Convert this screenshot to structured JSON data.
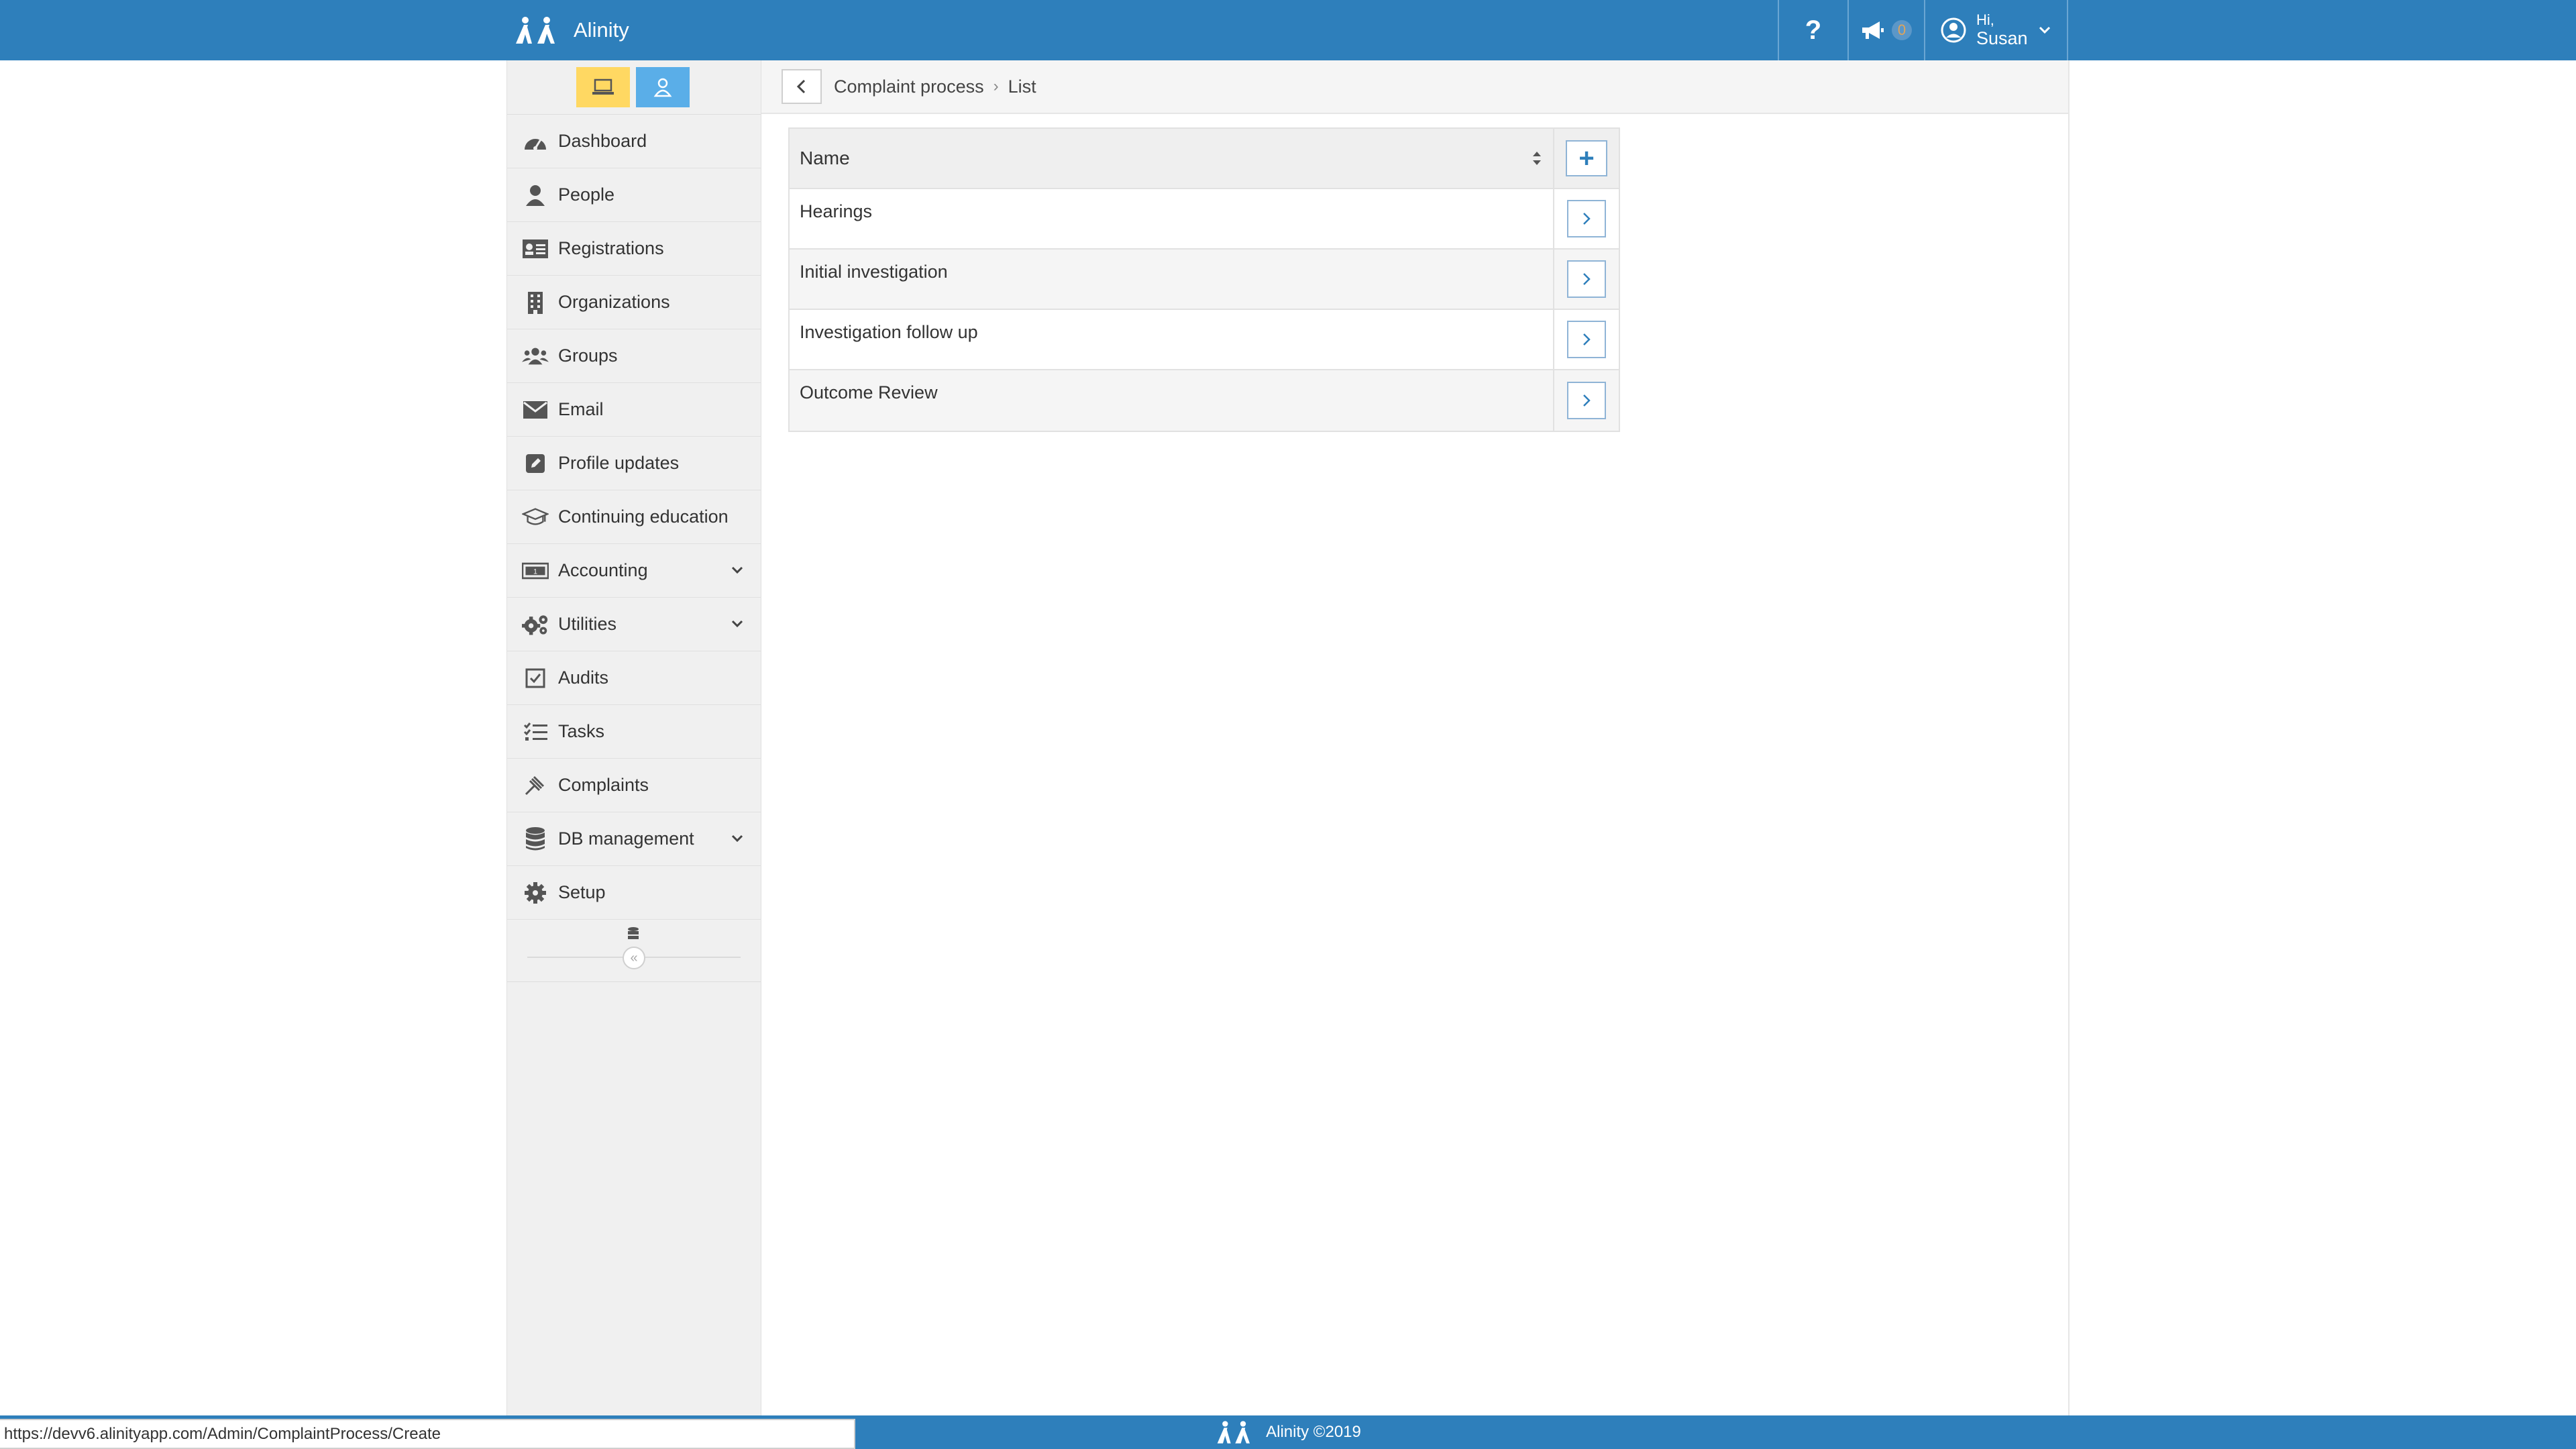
{
  "app": {
    "name": "Alinity"
  },
  "header": {
    "help_label": "?",
    "notification_count": "0",
    "greeting": "Hi,",
    "user_name": "Susan"
  },
  "breadcrumb": {
    "items": [
      "Complaint process",
      "List"
    ]
  },
  "sidebar": {
    "items": [
      {
        "label": "Dashboard",
        "icon": "dashboard-icon"
      },
      {
        "label": "People",
        "icon": "person-icon"
      },
      {
        "label": "Registrations",
        "icon": "id-card-icon"
      },
      {
        "label": "Organizations",
        "icon": "building-icon"
      },
      {
        "label": "Groups",
        "icon": "users-icon"
      },
      {
        "label": "Email",
        "icon": "envelope-icon"
      },
      {
        "label": "Profile updates",
        "icon": "edit-icon"
      },
      {
        "label": "Continuing education",
        "icon": "graduation-cap-icon"
      },
      {
        "label": "Accounting",
        "icon": "money-icon",
        "expandable": true
      },
      {
        "label": "Utilities",
        "icon": "cogs-icon",
        "expandable": true
      },
      {
        "label": "Audits",
        "icon": "checkbox-icon"
      },
      {
        "label": "Tasks",
        "icon": "list-check-icon"
      },
      {
        "label": "Complaints",
        "icon": "gavel-icon"
      },
      {
        "label": "DB management",
        "icon": "database-icon",
        "expandable": true
      },
      {
        "label": "Setup",
        "icon": "gear-icon"
      }
    ]
  },
  "grid": {
    "column_header": "Name",
    "rows": [
      {
        "name": "Hearings"
      },
      {
        "name": "Initial investigation"
      },
      {
        "name": "Investigation follow up"
      },
      {
        "name": "Outcome Review"
      }
    ]
  },
  "footer": {
    "text": "Alinity ©2019"
  },
  "status_url": "https://devv6.alinityapp.com/Admin/ComplaintProcess/Create",
  "colors": {
    "brand": "#2e7fbb",
    "mode_a": "#ffd862",
    "mode_b": "#5aaee8"
  }
}
